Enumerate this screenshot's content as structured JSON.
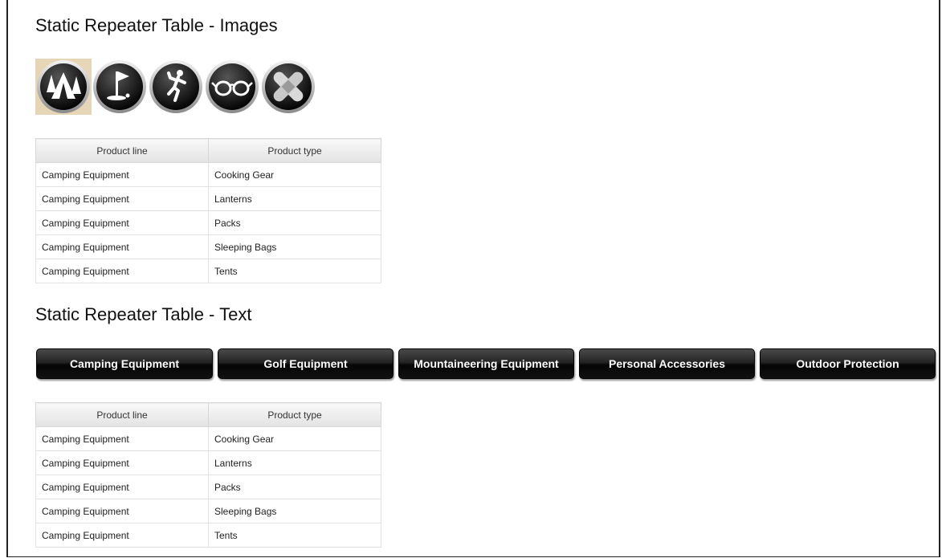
{
  "sections": {
    "images_title": "Static Repeater Table - Images",
    "text_title": "Static Repeater Table - Text"
  },
  "image_buttons": [
    {
      "icon": "tent-icon",
      "selected": true
    },
    {
      "icon": "golf-flag-icon",
      "selected": false
    },
    {
      "icon": "climber-icon",
      "selected": false
    },
    {
      "icon": "glasses-icon",
      "selected": false
    },
    {
      "icon": "bandage-icon",
      "selected": false
    }
  ],
  "text_buttons": [
    {
      "label": "Camping Equipment"
    },
    {
      "label": "Golf Equipment"
    },
    {
      "label": "Mountaineering Equipment"
    },
    {
      "label": "Personal Accessories"
    },
    {
      "label": "Outdoor Protection"
    }
  ],
  "table_images": {
    "headers": [
      "Product line",
      "Product type"
    ],
    "rows": [
      [
        "Camping Equipment",
        "Cooking Gear"
      ],
      [
        "Camping Equipment",
        "Lanterns"
      ],
      [
        "Camping Equipment",
        "Packs"
      ],
      [
        "Camping Equipment",
        "Sleeping Bags"
      ],
      [
        "Camping Equipment",
        "Tents"
      ]
    ]
  },
  "table_text": {
    "headers": [
      "Product line",
      "Product type"
    ],
    "rows": [
      [
        "Camping Equipment",
        "Cooking Gear"
      ],
      [
        "Camping Equipment",
        "Lanterns"
      ],
      [
        "Camping Equipment",
        "Packs"
      ],
      [
        "Camping Equipment",
        "Sleeping Bags"
      ],
      [
        "Camping Equipment",
        "Tents"
      ]
    ]
  },
  "colors": {
    "button_dark": "#1a1a1a",
    "selected_highlight": "#e7d5b7",
    "icon_ring": "#cfcfcf"
  }
}
